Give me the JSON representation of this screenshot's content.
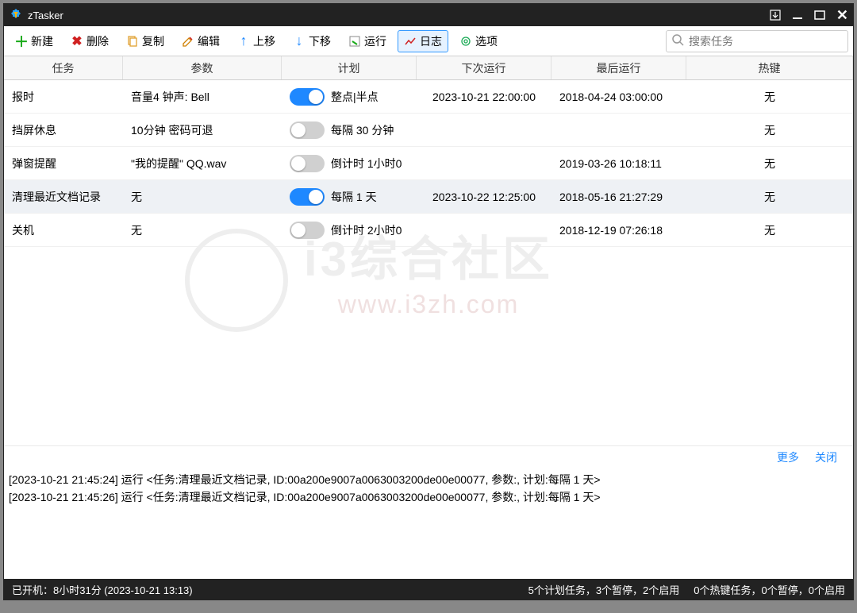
{
  "app": {
    "title": "zTasker"
  },
  "toolbar": {
    "new": "新建",
    "delete": "删除",
    "copy": "复制",
    "edit": "编辑",
    "up": "上移",
    "down": "下移",
    "run": "运行",
    "log": "日志",
    "options": "选项",
    "search_placeholder": "搜索任务"
  },
  "columns": {
    "task": "任务",
    "params": "参数",
    "schedule": "计划",
    "next": "下次运行",
    "last": "最后运行",
    "hotkey": "热键"
  },
  "rows": [
    {
      "task": "报时",
      "params": "音量4 钟声: Bell",
      "on": true,
      "schedule": "整点|半点",
      "next": "2023-10-21 22:00:00",
      "last": "2018-04-24 03:00:00",
      "hotkey": "无",
      "sel": false
    },
    {
      "task": "挡屏休息",
      "params": "10分钟 密码可退",
      "on": false,
      "schedule": "每隔 30 分钟",
      "next": "",
      "last": "",
      "hotkey": "无",
      "sel": false
    },
    {
      "task": "弹窗提醒",
      "params": "\"我的提醒\" QQ.wav",
      "on": false,
      "schedule": "倒计时 1小时0",
      "next": "",
      "last": "2019-03-26 10:18:11",
      "hotkey": "无",
      "sel": false
    },
    {
      "task": "清理最近文档记录",
      "params": "无",
      "on": true,
      "schedule": "每隔 1 天",
      "next": "2023-10-22 12:25:00",
      "last": "2018-05-16 21:27:29",
      "hotkey": "无",
      "sel": true
    },
    {
      "task": "关机",
      "params": "无",
      "on": false,
      "schedule": "倒计时 2小时0",
      "next": "",
      "last": "2018-12-19 07:26:18",
      "hotkey": "无",
      "sel": false
    }
  ],
  "log_links": {
    "more": "更多",
    "close": "关闭"
  },
  "log": [
    "[2023-10-21 21:45:24] 运行 <任务:清理最近文档记录, ID:00a200e9007a0063003200de00e00077, 参数:, 计划:每隔 1 天>",
    "[2023-10-21 21:45:26] 运行 <任务:清理最近文档记录, ID:00a200e9007a0063003200de00e00077, 参数:, 计划:每隔 1 天>"
  ],
  "status": {
    "uptime": "已开机：8小时31分 (2023-10-21 13:13)",
    "plan": "5个计划任务，3个暂停，2个启用",
    "hotkey": "0个热键任务，0个暂停，0个启用"
  },
  "watermark": {
    "big": "i3综合社区",
    "url": "www.i3zh.com"
  }
}
